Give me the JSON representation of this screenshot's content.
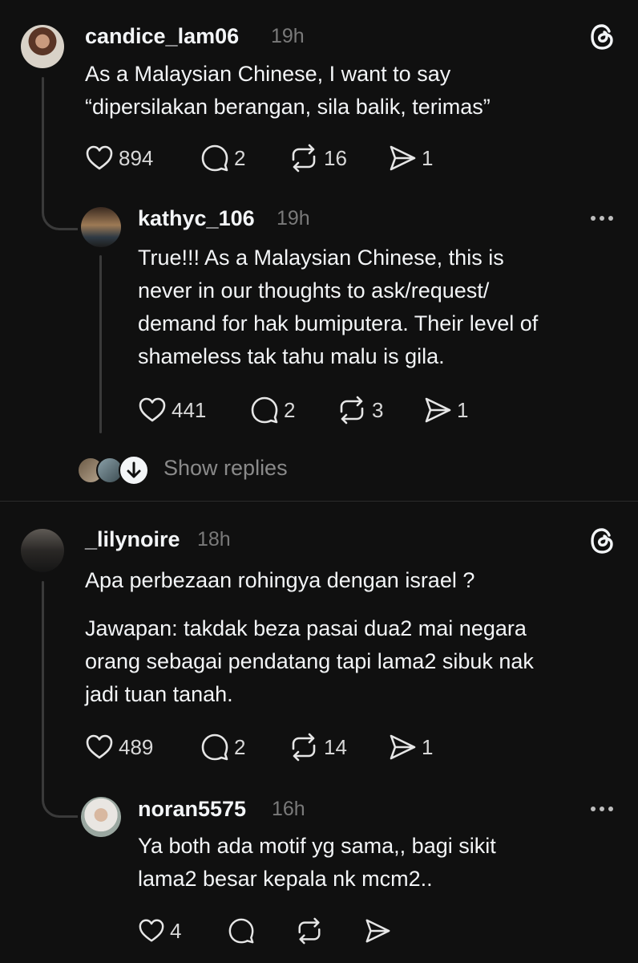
{
  "posts": [
    {
      "username": "candice_lam06",
      "time": "19h",
      "lines": "As a Malaysian Chinese, I want to say\n“dipersilakan berangan, sila balik, terimas”",
      "likes": "894",
      "replies": "2",
      "reposts": "16",
      "shares": "1",
      "reply": {
        "username": "kathyc_106",
        "time": "19h",
        "lines": "True!!! As a Malaysian Chinese, this is\nnever in our thoughts to ask/request/\ndemand for hak bumiputera. Their level of\nshameless tak tahu malu is gila.",
        "likes": "441",
        "replies": "2",
        "reposts": "3",
        "shares": "1"
      },
      "show_replies": "Show replies"
    },
    {
      "username": "_lilynoire",
      "time": "18h",
      "lines": "Apa perbezaan rohingya dengan israel ?",
      "lines2": "Jawapan: takdak beza pasai dua2 mai negara\norang sebagai pendatang tapi lama2 sibuk nak\njadi tuan tanah.",
      "likes": "489",
      "replies": "2",
      "reposts": "14",
      "shares": "1",
      "reply": {
        "username": "noran5575",
        "time": "16h",
        "lines": "Ya both ada motif yg sama,, bagi sikit\nlama2 besar kepala nk mcm2..",
        "likes": "4"
      }
    }
  ],
  "icons": {
    "like": "heart-icon",
    "reply": "comment-icon",
    "repost": "repost-icon",
    "share": "send-icon",
    "threads": "threads-logo-icon",
    "more": "more-icon"
  }
}
